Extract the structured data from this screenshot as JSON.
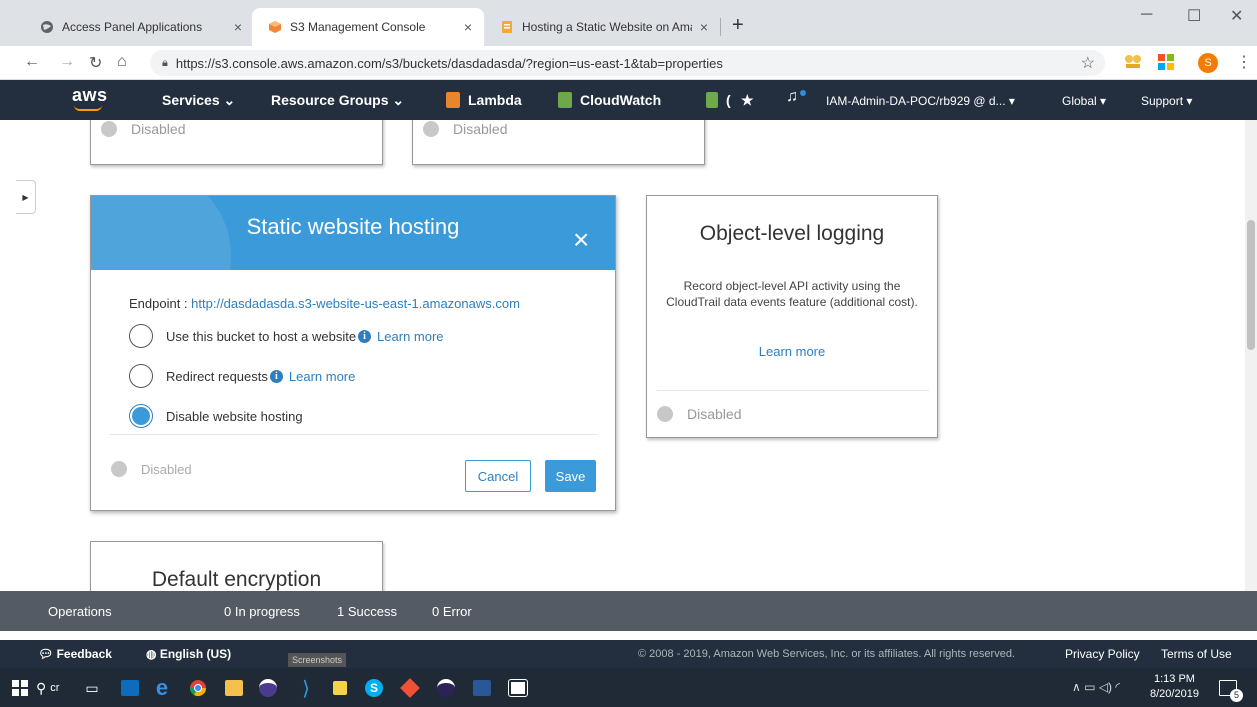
{
  "browser": {
    "tabs": [
      {
        "title": "Access Panel Applications",
        "close": "×"
      },
      {
        "title": "S3 Management Console",
        "close": "×"
      },
      {
        "title": "Hosting a Static Website on Ama",
        "close": "×"
      }
    ],
    "new_tab": "+",
    "url": "https://s3.console.aws.amazon.com/s3/buckets/dasdadasda/?region=us-east-1&tab=properties",
    "profile_initial": "S"
  },
  "aws_nav": {
    "logo": "aws",
    "services": "Services ⌄",
    "resource_groups": "Resource Groups ⌄",
    "lambda": "Lambda",
    "cloudwatch": "CloudWatch",
    "pin_extra": "(",
    "account": "IAM-Admin-DA-POC/rb929 @ d... ▾",
    "region": "Global ▾",
    "support": "Support ▾"
  },
  "cards": {
    "top_left_status": "Disabled",
    "top_middle_status": "Disabled",
    "object_logging": {
      "title": "Object-level logging",
      "description": "Record object-level API activity using the CloudTrail data events feature (additional cost).",
      "learn_more": "Learn more",
      "status": "Disabled"
    },
    "default_encryption": {
      "title": "Default encryption"
    }
  },
  "static_hosting": {
    "title": "Static website hosting",
    "close": "×",
    "endpoint_label": "Endpoint : ",
    "endpoint_url": "http://dasdadasda.s3-website-us-east-1.amazonaws.com",
    "options": [
      {
        "label": "Use this bucket to host a website",
        "learn_more": "Learn more",
        "info": true,
        "checked": false
      },
      {
        "label": "Redirect requests",
        "learn_more": "Learn more",
        "info": true,
        "checked": false
      },
      {
        "label": "Disable website hosting",
        "learn_more": "",
        "info": false,
        "checked": true
      }
    ],
    "status": "Disabled",
    "cancel_label": "Cancel",
    "save_label": "Save"
  },
  "operations": {
    "label": "Operations",
    "in_progress": "0 In progress",
    "success": "1 Success",
    "error": "0 Error"
  },
  "footer": {
    "feedback": "Feedback",
    "language": "English (US)",
    "copyright": "© 2008 - 2019, Amazon Web Services, Inc. or its affiliates. All rights reserved.",
    "privacy": "Privacy Policy",
    "terms": "Terms of Use",
    "tooltip": "Screenshots"
  },
  "taskbar": {
    "search_text": "cr",
    "time": "1:13 PM",
    "date": "8/20/2019",
    "notifications": "5"
  },
  "colors": {
    "aws_nav_bg": "#232f3e",
    "modal_header": "#3b9ad9",
    "link": "#2e7fbf",
    "aws_orange": "#ff9900"
  }
}
